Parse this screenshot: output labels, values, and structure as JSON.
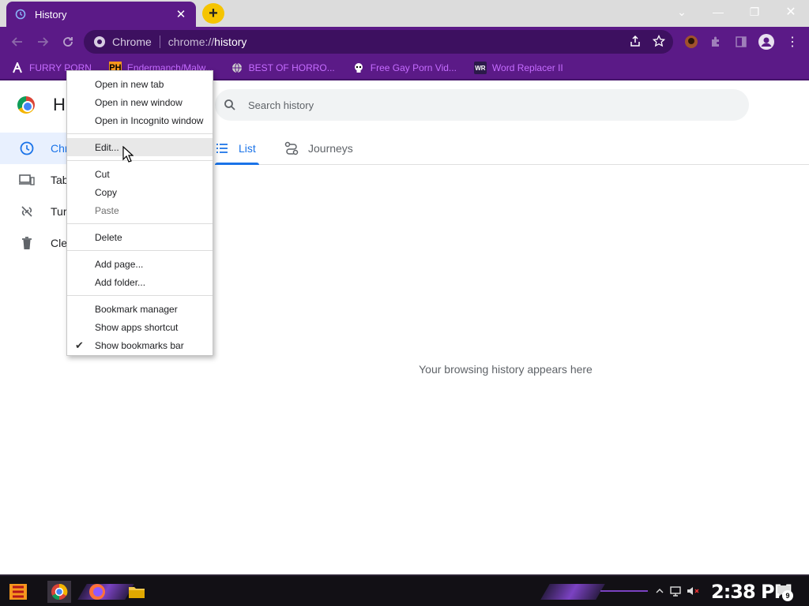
{
  "tab": {
    "title": "History",
    "close": "✕",
    "new_tab": "+"
  },
  "window": {
    "minimize": "—",
    "restore": "❐",
    "close": "✕",
    "dropdown": "⌄"
  },
  "omnibox": {
    "site_label": "Chrome",
    "url_scheme": "chrome://",
    "url_host": "history"
  },
  "bookmarks": [
    {
      "label": "FURRY PORN",
      "icon": "A",
      "icon_color": "#c56cff"
    },
    {
      "label": "Endermanch/Malw...",
      "icon": "PH",
      "icon_color": "#f7971d"
    },
    {
      "label": "BEST OF HORRO...",
      "icon": "globe",
      "icon_color": "#ccc"
    },
    {
      "label": "Free Gay Porn Vid...",
      "icon": "skull",
      "icon_color": "#fff"
    },
    {
      "label": "Word Replacer II",
      "icon": "WR",
      "icon_color": "#9b5cff"
    }
  ],
  "page": {
    "title": "H",
    "search_placeholder": "Search history",
    "empty_message": "Your browsing history appears here"
  },
  "sidebar": {
    "items": [
      {
        "label": "Chr",
        "icon": "clock-icon",
        "active": true
      },
      {
        "label": "Tab",
        "icon": "devices-icon",
        "active": false
      },
      {
        "label": "Tur",
        "icon": "link-off-icon",
        "active": false
      },
      {
        "label": "Cle",
        "icon": "trash-icon",
        "active": false
      }
    ]
  },
  "tabs": [
    {
      "label": "List",
      "active": true
    },
    {
      "label": "Journeys",
      "active": false
    }
  ],
  "context_menu": {
    "group1": [
      "Open in new tab",
      "Open in new window",
      "Open in Incognito window"
    ],
    "edit": "Edit...",
    "group2": [
      "Cut",
      "Copy",
      "Paste"
    ],
    "delete": "Delete",
    "group3": [
      "Add page...",
      "Add folder..."
    ],
    "group4": [
      "Bookmark manager",
      "Show apps shortcut",
      "Show bookmarks bar"
    ],
    "checkmark": "✔"
  },
  "taskbar": {
    "clock": "2:38 PM",
    "notification_count": "9"
  },
  "colors": {
    "theme_purple": "#5b1a87",
    "accent_blue": "#1a73e8",
    "new_tab_yellow": "#f5c400"
  }
}
